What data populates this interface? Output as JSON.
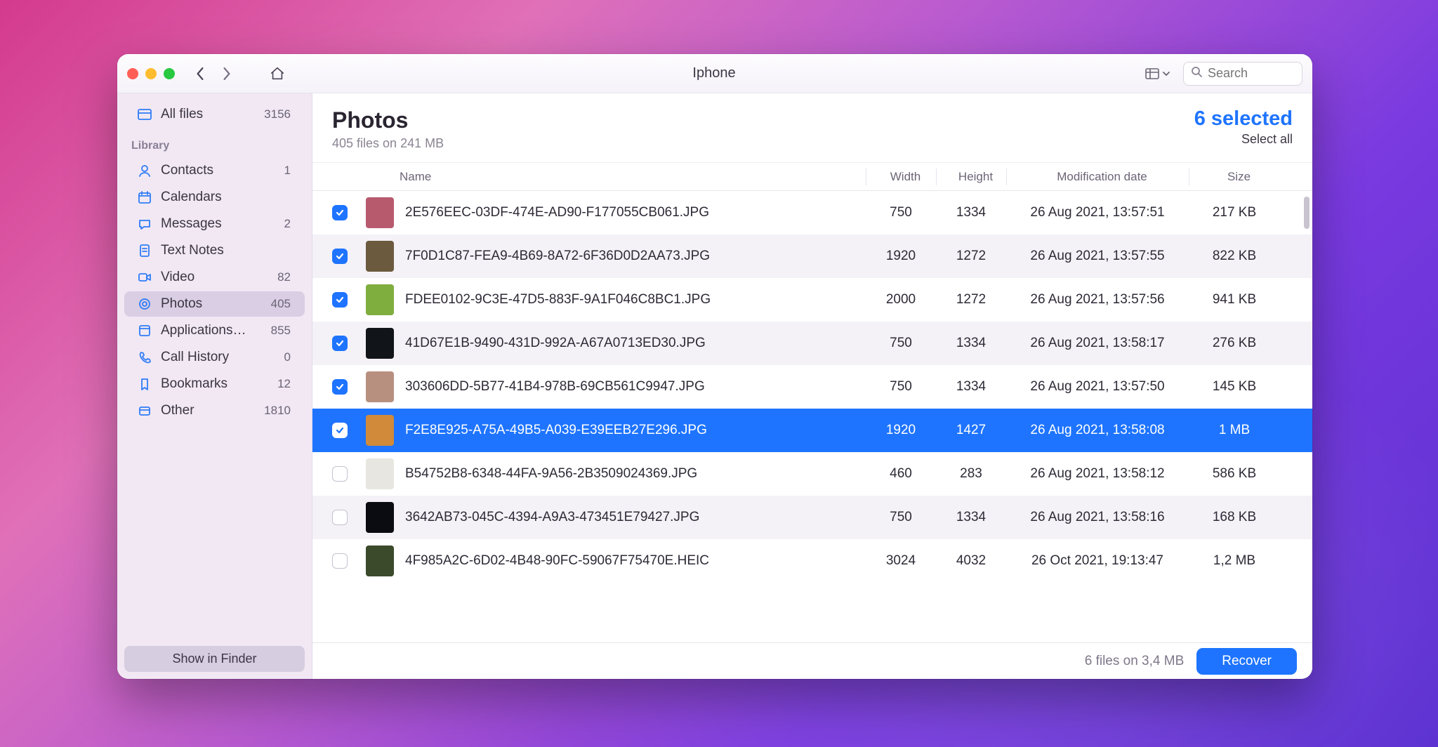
{
  "window": {
    "title": "Iphone"
  },
  "search": {
    "placeholder": "Search"
  },
  "sidebar": {
    "all_files": {
      "label": "All files",
      "count": "3156"
    },
    "section_label": "Library",
    "items": [
      {
        "id": "contacts",
        "label": "Contacts",
        "count": "1",
        "icon": "contacts"
      },
      {
        "id": "calendars",
        "label": "Calendars",
        "count": "",
        "icon": "calendar"
      },
      {
        "id": "messages",
        "label": "Messages",
        "count": "2",
        "icon": "message"
      },
      {
        "id": "textnotes",
        "label": "Text Notes",
        "count": "",
        "icon": "note"
      },
      {
        "id": "video",
        "label": "Video",
        "count": "82",
        "icon": "video"
      },
      {
        "id": "photos",
        "label": "Photos",
        "count": "405",
        "icon": "photo",
        "active": true
      },
      {
        "id": "apps",
        "label": "Applications…",
        "count": "855",
        "icon": "app"
      },
      {
        "id": "callhist",
        "label": "Call History",
        "count": "0",
        "icon": "phone"
      },
      {
        "id": "bookmarks",
        "label": "Bookmarks",
        "count": "12",
        "icon": "bookmark"
      },
      {
        "id": "other",
        "label": "Other",
        "count": "1810",
        "icon": "other"
      }
    ],
    "show_in_finder": "Show in Finder"
  },
  "header": {
    "title": "Photos",
    "subtitle": "405 files on 241 MB",
    "selected_text": "6 selected",
    "select_all": "Select all"
  },
  "columns": {
    "name": "Name",
    "width": "Width",
    "height": "Height",
    "date": "Modification date",
    "size": "Size"
  },
  "rows": [
    {
      "checked": true,
      "selected": false,
      "thumb": "#b85a6e",
      "name": "2E576EEC-03DF-474E-AD90-F177055CB061.JPG",
      "w": "750",
      "h": "1334",
      "date": "26 Aug 2021, 13:57:51",
      "size": "217 KB"
    },
    {
      "checked": true,
      "selected": false,
      "thumb": "#6b5a3e",
      "name": "7F0D1C87-FEA9-4B69-8A72-6F36D0D2AA73.JPG",
      "w": "1920",
      "h": "1272",
      "date": "26 Aug 2021, 13:57:55",
      "size": "822 KB"
    },
    {
      "checked": true,
      "selected": false,
      "thumb": "#7fae3e",
      "name": "FDEE0102-9C3E-47D5-883F-9A1F046C8BC1.JPG",
      "w": "2000",
      "h": "1272",
      "date": "26 Aug 2021, 13:57:56",
      "size": "941 KB"
    },
    {
      "checked": true,
      "selected": false,
      "thumb": "#111418",
      "name": "41D67E1B-9490-431D-992A-A67A0713ED30.JPG",
      "w": "750",
      "h": "1334",
      "date": "26 Aug 2021, 13:58:17",
      "size": "276 KB"
    },
    {
      "checked": true,
      "selected": false,
      "thumb": "#b89080",
      "name": "303606DD-5B77-41B4-978B-69CB561C9947.JPG",
      "w": "750",
      "h": "1334",
      "date": "26 Aug 2021, 13:57:50",
      "size": "145 KB"
    },
    {
      "checked": true,
      "selected": true,
      "thumb": "#d08a3a",
      "name": "F2E8E925-A75A-49B5-A039-E39EEB27E296.JPG",
      "w": "1920",
      "h": "1427",
      "date": "26 Aug 2021, 13:58:08",
      "size": "1 MB"
    },
    {
      "checked": false,
      "selected": false,
      "thumb": "#e8e6e0",
      "name": "B54752B8-6348-44FA-9A56-2B3509024369.JPG",
      "w": "460",
      "h": "283",
      "date": "26 Aug 2021, 13:58:12",
      "size": "586 KB"
    },
    {
      "checked": false,
      "selected": false,
      "thumb": "#0a0c12",
      "name": "3642AB73-045C-4394-A9A3-473451E79427.JPG",
      "w": "750",
      "h": "1334",
      "date": "26 Aug 2021, 13:58:16",
      "size": "168 KB"
    },
    {
      "checked": false,
      "selected": false,
      "thumb": "#3a4a2a",
      "name": "4F985A2C-6D02-4B48-90FC-59067F75470E.HEIC",
      "w": "3024",
      "h": "4032",
      "date": "26 Oct 2021, 19:13:47",
      "size": "1,2 MB"
    }
  ],
  "footer": {
    "info": "6 files on 3,4 MB",
    "recover": "Recover"
  }
}
